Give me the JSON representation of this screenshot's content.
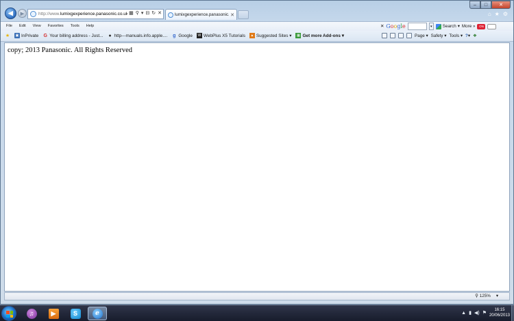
{
  "window": {
    "address_url_prefix": "http://www.",
    "address_url_domain": "lumixgexperience.panasonic.co.uk",
    "address_url_suffix": "/",
    "tab_title": "lumixgexperience.panasonic.co.uk",
    "controls": {
      "minimize": "–",
      "maximize": "□",
      "close": "✕"
    },
    "right_icons": {
      "home": "⌂",
      "favorites": "★",
      "tools": "⚙"
    }
  },
  "menu": {
    "items": [
      "File",
      "Edit",
      "View",
      "Favorites",
      "Tools",
      "Help"
    ]
  },
  "google_toolbar": {
    "close": "✕",
    "search_label": "Search",
    "more_label": "More »",
    "toggle_label": "ON"
  },
  "favorites_bar": {
    "items": [
      {
        "label": "InPrivate",
        "icon": "inprivate-icon"
      },
      {
        "label": "Your billing address - Just...",
        "icon": "google-g-icon"
      },
      {
        "label": "http---manuals.info.apple....",
        "icon": "apple-icon"
      },
      {
        "label": "Google",
        "icon": "google-g-icon"
      },
      {
        "label": "WebPlus X5 Tutorials",
        "icon": "webplus-icon"
      },
      {
        "label": "Suggested Sites ▾",
        "icon": "suggested-sites-icon"
      },
      {
        "label": "Get more Add-ons ▾",
        "icon": "addons-icon"
      }
    ]
  },
  "command_bar": {
    "page_label": "Page ▾",
    "safety_label": "Safety ▾",
    "tools_label": "Tools ▾",
    "help_label": "▾"
  },
  "content": {
    "text": "copy; 2013 Panasonic. All Rights Reserved"
  },
  "status_bar": {
    "zoom": "125%",
    "zoom_dropdown": "▾"
  },
  "taskbar": {
    "time": "16:15",
    "date": "20/06/2013",
    "apps": [
      {
        "name": "itunes",
        "glyph": "♫"
      },
      {
        "name": "vlc",
        "glyph": "▶"
      },
      {
        "name": "skype",
        "glyph": "S"
      },
      {
        "name": "internet-explorer",
        "glyph": "e"
      }
    ]
  },
  "colors": {
    "window_chrome": "#c7d9ec",
    "content_bg": "#ffffff",
    "taskbar": "#1c2334"
  }
}
